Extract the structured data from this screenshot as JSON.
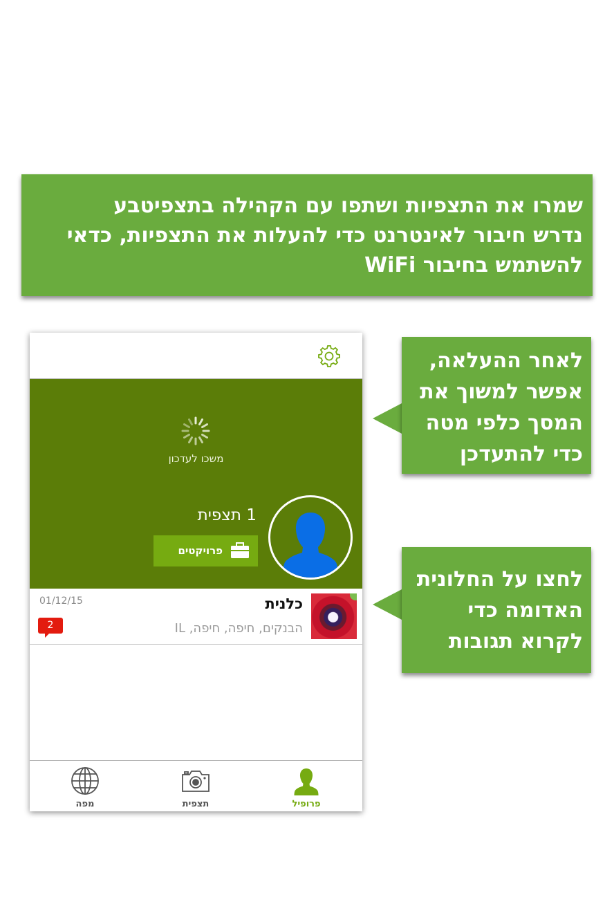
{
  "top_callout": {
    "lines": [
      "שמרו את התצפיות ושתפו עם הקהילה בתצפיטבע",
      "נדרש חיבור לאינטרנט כדי להעלות את התצפיות, כדאי",
      "להשתמש בחיבור WiFi"
    ]
  },
  "side_callout_refresh": {
    "lines": [
      "לאחר ההעלאה,",
      "אפשר למשוך את",
      "המסך כלפי מטה",
      "כדי להתעדכן"
    ]
  },
  "side_callout_comments": {
    "lines": [
      "לחצו על החלונית",
      "האדומה כדי",
      "לקרוא תגובות"
    ]
  },
  "app": {
    "pull_to_refresh_text": "משכו לעדכון",
    "observations_count": "1 תצפית",
    "projects_button": "פרויקטים",
    "observation": {
      "title": "כלנית",
      "location": "הבנקים, חיפה, חיפה, IL",
      "date": "01/12/15",
      "comments_badge": "2"
    },
    "tabs": {
      "map": "מפה",
      "observation": "תצפית",
      "profile": "פרופיל"
    }
  },
  "colors": {
    "callout_green": "#6aac3e",
    "header_green": "#5b7d08",
    "accent_green": "#76ab11",
    "avatar_blue": "#0a6ee6",
    "badge_red": "#e31b0f"
  },
  "icons": [
    "gear-icon",
    "spinner-icon",
    "avatar-silhouette-icon",
    "briefcase-icon",
    "globe-icon",
    "camera-icon",
    "profile-icon"
  ]
}
